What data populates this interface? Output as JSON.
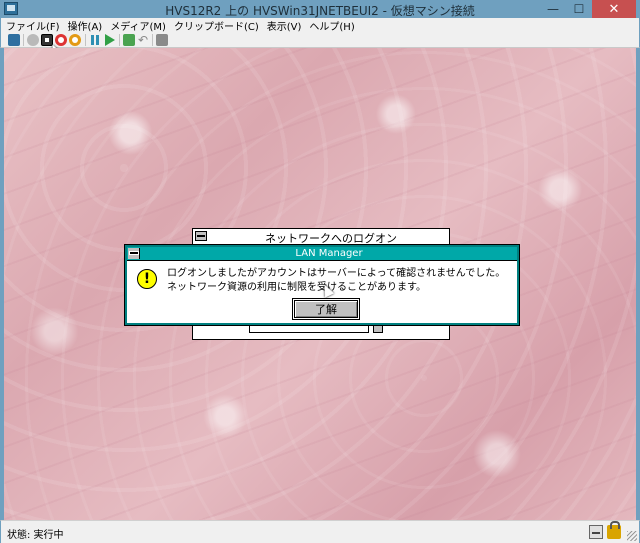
{
  "window": {
    "title": "HVS12R2 上の HVSWin31JNETBEUI2 - 仮想マシン接続",
    "minimize": "—",
    "maximize": "☐",
    "close": "✕"
  },
  "menubar": {
    "items": [
      {
        "label": "ファイル(F)"
      },
      {
        "label": "操作(A)"
      },
      {
        "label": "メディア(M)"
      },
      {
        "label": "クリップボード(C)"
      },
      {
        "label": "表示(V)"
      },
      {
        "label": "ヘルプ(H)"
      }
    ]
  },
  "toolbar": {
    "icons": [
      "ctrl-alt-del-icon",
      "start-icon",
      "turn-off-icon",
      "shut-down-icon",
      "save-state-icon",
      "pause-icon",
      "resume-icon",
      "checkpoint-icon",
      "revert-icon",
      "enhanced-session-icon"
    ]
  },
  "guest": {
    "logon_window": {
      "title": "ネットワークへのログオン"
    },
    "dialog": {
      "title": "LAN Manager",
      "message": "ログオンしましたがアカウントはサーバーによって確認されませんでした。ネットワーク資源の利用に制限を受けることがあります。",
      "ok_label": "了解",
      "icon": "warning-icon",
      "caption_color": "#00a8a8"
    }
  },
  "statusbar": {
    "status_text": "状態: 実行中"
  }
}
